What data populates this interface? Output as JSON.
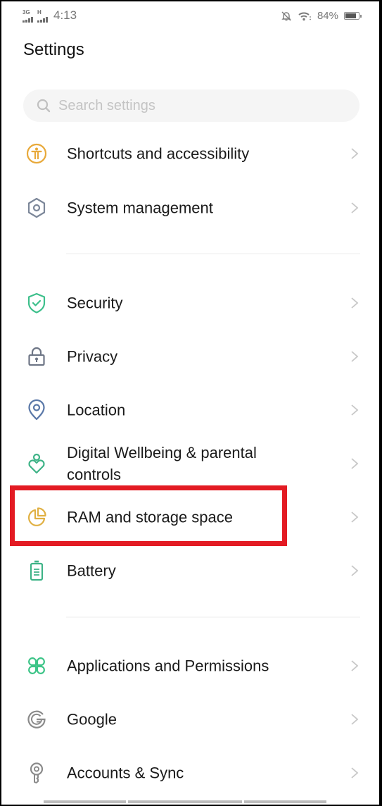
{
  "status_bar": {
    "network1": "3G",
    "network2": "H",
    "time": "4:13",
    "battery_percent": "84%",
    "battery_level": 0.84,
    "icons": [
      "signal-3g-icon",
      "signal-h-icon",
      "notifications-off-icon",
      "wifi-icon",
      "battery-icon"
    ]
  },
  "header": {
    "title": "Settings"
  },
  "search": {
    "placeholder": "Search settings",
    "value": ""
  },
  "settings_items": [
    {
      "label": "Shortcuts and accessibility",
      "icon": "accessibility-icon",
      "color": "#e8a93a"
    },
    {
      "label": "System management",
      "icon": "hexagon-settings-icon",
      "color": "#7c8799"
    },
    {
      "label": "Security",
      "icon": "shield-check-icon",
      "color": "#3cbf8b"
    },
    {
      "label": "Privacy",
      "icon": "lock-icon",
      "color": "#6e7686"
    },
    {
      "label": "Location",
      "icon": "location-pin-icon",
      "color": "#5a78a8"
    },
    {
      "label": "Digital Wellbeing & parental controls",
      "icon": "wellbeing-heart-icon",
      "color": "#3eb387"
    },
    {
      "label": "RAM and storage space",
      "icon": "pie-chart-icon",
      "color": "#e0b042"
    },
    {
      "label": "Battery",
      "icon": "battery-list-icon",
      "color": "#3eb387"
    },
    {
      "label": "Applications and Permissions",
      "icon": "apps-grid-icon",
      "color": "#3cc487"
    },
    {
      "label": "Google",
      "icon": "google-icon",
      "color": "#8a8a8a"
    },
    {
      "label": "Accounts & Sync",
      "icon": "key-icon",
      "color": "#8a8a8a"
    }
  ],
  "highlight": {
    "target": "RAM and storage space",
    "color": "#e31b23"
  }
}
